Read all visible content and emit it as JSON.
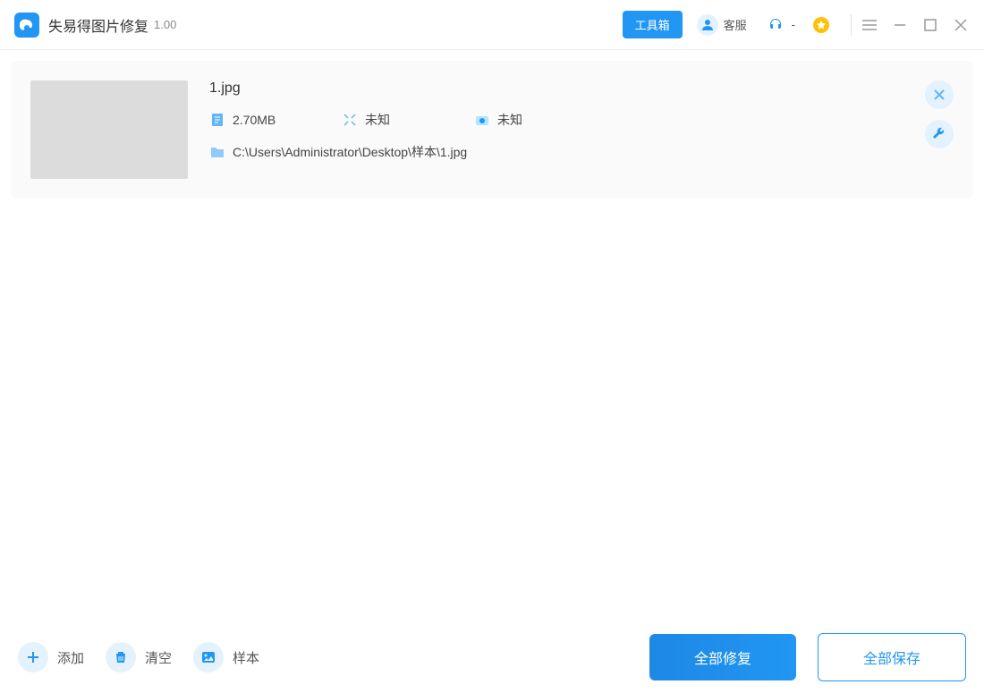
{
  "app": {
    "title": "失易得图片修复",
    "version": "1.00"
  },
  "header": {
    "toolbox": "工具箱",
    "service": "客服",
    "headset_label": "-"
  },
  "files": [
    {
      "name": "1.jpg",
      "size": "2.70MB",
      "dimensions": "未知",
      "camera": "未知",
      "path": "C:\\Users\\Administrator\\Desktop\\样本\\1.jpg"
    }
  ],
  "footer": {
    "add": "添加",
    "clear": "清空",
    "sample": "样本",
    "repair_all": "全部修复",
    "save_all": "全部保存"
  }
}
